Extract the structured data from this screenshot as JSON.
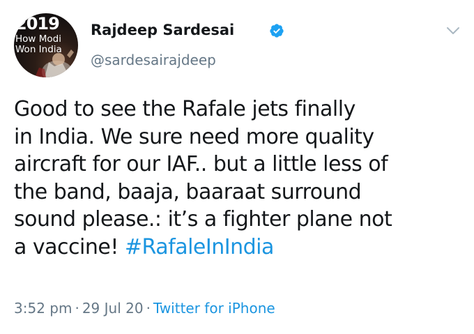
{
  "avatar": {
    "year": "2019",
    "line1": "How Modi",
    "line2": "Won India"
  },
  "author": {
    "display_name": "Rajdeep Sardesai",
    "handle": "@sardesairajdeep",
    "verified": true
  },
  "tweet": {
    "lines": [
      "Good to see the Rafale jets finally",
      "in India. We sure need more quality",
      "aircraft for our IAF.. but a little less of",
      "the band, baaja, baaraat surround",
      "sound please.: it’s a fighter plane not"
    ],
    "last_line_text": "a vaccine! ",
    "hashtag": "#RafaleInIndia"
  },
  "meta": {
    "time": "3:52 pm",
    "date": "29 Jul 20",
    "separator": "·",
    "source": "Twitter for iPhone"
  },
  "colors": {
    "link": "#1b95e0",
    "secondary_text": "#657786",
    "primary_text": "#14171a",
    "verified_badge": "#1da1f2"
  },
  "icons": {
    "verified": "verified-badge-icon",
    "menu": "chevron-down-icon"
  }
}
